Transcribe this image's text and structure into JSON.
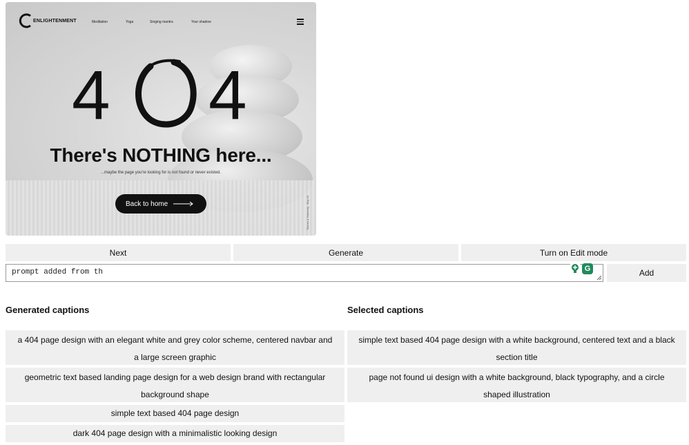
{
  "preview": {
    "logo_text": "ENLIGHTENMENT",
    "nav": [
      "Meditation",
      "Yoga",
      "Singing mantra",
      "Your shadow"
    ],
    "error_digit_left": "4",
    "error_digit_right": "4",
    "headline": "There's NOTHING here...",
    "subline": "...maybe the page you're looking for is not found or never existed.",
    "home_button": "Back to home",
    "side_credit": "Stones & Harmony - Bay 10"
  },
  "controls": {
    "next_label": "Next",
    "generate_label": "Generate",
    "edit_mode_label": "Turn on Edit mode",
    "prompt_value": "prompt added from th",
    "add_label": "Add"
  },
  "generated": {
    "title": "Generated captions",
    "items": [
      "a 404 page design with an elegant white and grey color scheme, centered navbar and a large screen graphic",
      "geometric text based landing page design for a web design brand with rectangular background shape",
      "simple text based 404 page design",
      "dark 404 page design with a minimalistic looking design"
    ]
  },
  "selected": {
    "title": "Selected captions",
    "items": [
      "simple text based 404 page design with a white background, centered text and a black section title",
      "page not found ui design with a white background, black typography, and a circle shaped illustration"
    ]
  },
  "colors": {
    "button_bg": "#efefef",
    "preview_button": "#111111",
    "extension_green": "#1f8a5c"
  }
}
